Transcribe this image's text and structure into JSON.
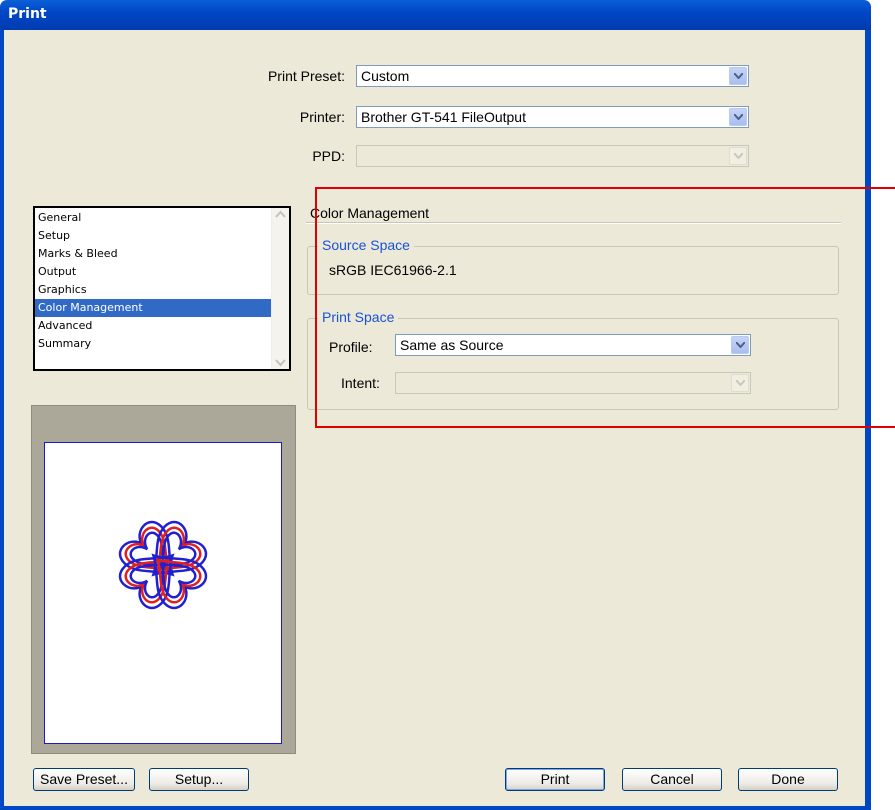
{
  "window": {
    "title": "Print"
  },
  "top": {
    "preset_label": "Print Preset:",
    "preset_value": "Custom",
    "printer_label": "Printer:",
    "printer_value": "Brother GT-541 FileOutput",
    "ppd_label": "PPD:",
    "ppd_value": ""
  },
  "sidebar": {
    "items": [
      {
        "label": "General"
      },
      {
        "label": "Setup"
      },
      {
        "label": "Marks & Bleed"
      },
      {
        "label": "Output"
      },
      {
        "label": "Graphics"
      },
      {
        "label": "Color Management",
        "selected": true
      },
      {
        "label": "Advanced"
      },
      {
        "label": "Summary"
      }
    ]
  },
  "color_management": {
    "title": "Color Management",
    "source_space": {
      "title": "Source Space",
      "value": "sRGB IEC61966-2.1"
    },
    "print_space": {
      "title": "Print Space",
      "profile_label": "Profile:",
      "profile_value": "Same as Source",
      "intent_label": "Intent:",
      "intent_value": ""
    }
  },
  "buttons": {
    "save_preset": "Save Preset...",
    "setup": "Setup...",
    "print": "Print",
    "cancel": "Cancel",
    "done": "Done"
  },
  "colors": {
    "selection": "#316ac5",
    "highlight_box": "#e00000",
    "group_title": "#1853d6"
  },
  "preview": {
    "artwork": "four-heart-clover-icon"
  }
}
